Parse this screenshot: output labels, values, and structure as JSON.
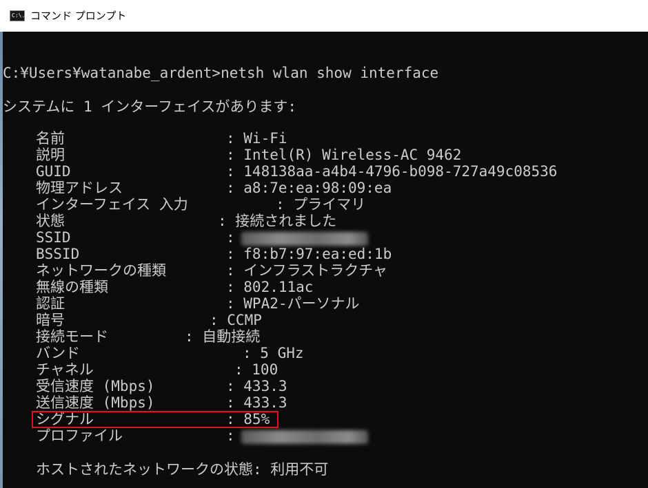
{
  "window": {
    "title": "コマンド プロンプト",
    "icon_label": "C:\\."
  },
  "console": {
    "prompt_line": "C:¥Users¥watanabe_ardent>netsh wlan show interface",
    "summary_line": "システムに 1 インターフェイスがあります:",
    "fields": [
      {
        "label": "名前",
        "value": ": Wi-Fi"
      },
      {
        "label": "説明",
        "value": ": Intel(R) Wireless-AC 9462"
      },
      {
        "label": "GUID",
        "value": ": 148138aa-a4b4-4796-b098-727a49c08536"
      },
      {
        "label": "物理アドレス",
        "value": ": a8:7e:ea:98:09:ea"
      },
      {
        "label": "インターフェイス 入力",
        "value": ": プライマリ"
      },
      {
        "label": "状態",
        "value": ": 接続されました"
      },
      {
        "label": "SSID",
        "value": ":"
      },
      {
        "label": "BSSID",
        "value": ": f8:b7:97:ea:ed:1b"
      },
      {
        "label": "ネットワークの種類",
        "value": ": インフラストラクチャ"
      },
      {
        "label": "無線の種類",
        "value": ": 802.11ac"
      },
      {
        "label": "認証",
        "value": ": WPA2-パーソナル"
      },
      {
        "label": "暗号",
        "value": ": CCMP"
      },
      {
        "label": "接続モード",
        "value": ": 自動接続"
      },
      {
        "label": "バンド",
        "value": ": 5 GHz"
      },
      {
        "label": "チャネル",
        "value": ": 100"
      },
      {
        "label": "受信速度 (Mbps)",
        "value": ": 433.3"
      },
      {
        "label": "送信速度 (Mbps)",
        "value": ": 433.3"
      },
      {
        "label": "シグナル",
        "value": ": 85%"
      },
      {
        "label": "プロファイル",
        "value": ":"
      }
    ],
    "hosted_line": "ホストされたネットワークの状態: 利用不可"
  },
  "colors": {
    "console_bg": "#0c0c0c",
    "console_text": "#cccccc",
    "highlight": "#e0141e"
  }
}
